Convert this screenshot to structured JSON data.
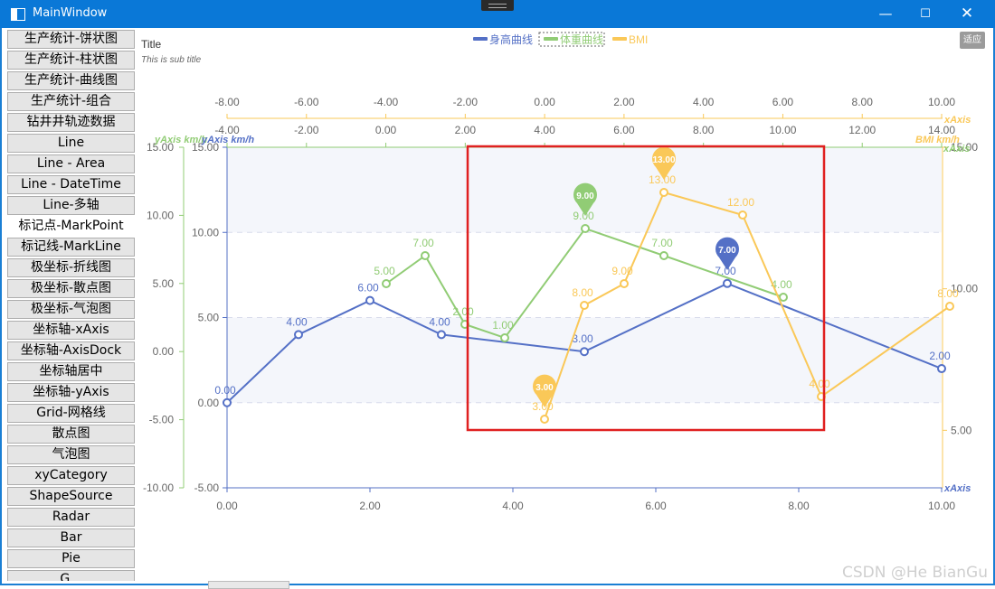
{
  "window": {
    "title": "MainWindow",
    "minimize_icon": "minimize-icon",
    "maximize_icon": "maximize-icon",
    "close_icon": "close-icon"
  },
  "sidebar": {
    "items": [
      {
        "label": "生产统计-饼状图"
      },
      {
        "label": "生产统计-柱状图"
      },
      {
        "label": "生产统计-曲线图"
      },
      {
        "label": "生产统计-组合"
      },
      {
        "label": "钻井井轨迹数据"
      },
      {
        "label": "Line"
      },
      {
        "label": "Line - Area"
      },
      {
        "label": "Line - DateTime"
      },
      {
        "label": "Line-多轴"
      },
      {
        "label": "标记点-MarkPoint",
        "selected": true
      },
      {
        "label": "标记线-MarkLine"
      },
      {
        "label": "极坐标-折线图"
      },
      {
        "label": "极坐标-散点图"
      },
      {
        "label": "极坐标-气泡图"
      },
      {
        "label": "坐标轴-xAxis"
      },
      {
        "label": "坐标轴-AxisDock"
      },
      {
        "label": "坐标轴居中"
      },
      {
        "label": "坐标轴-yAxis"
      },
      {
        "label": "Grid-网格线"
      },
      {
        "label": "散点图"
      },
      {
        "label": "气泡图"
      },
      {
        "label": "xyCategory"
      },
      {
        "label": "ShapeSource"
      },
      {
        "label": "Radar"
      },
      {
        "label": "Bar"
      },
      {
        "label": "Pie"
      },
      {
        "label": "G..."
      }
    ]
  },
  "toolbar": {
    "fit_label": "适应"
  },
  "watermark": "CSDN @He BianGu",
  "bottom_tab": "Radar",
  "chart_data": {
    "type": "line",
    "title": "Title",
    "subtitle": "This is sub title",
    "legend_position": "top",
    "legend": [
      "身高曲线",
      "体重曲线",
      "BMI"
    ],
    "colors": {
      "height": "#5470c6",
      "weight": "#91cc75",
      "bmi": "#fac858",
      "highlight": "#e02020"
    },
    "axes": {
      "x_bottom": {
        "label": "xAxis",
        "range": [
          0,
          10
        ],
        "ticks": [
          "0.00",
          "2.00",
          "4.00",
          "6.00",
          "8.00",
          "10.00"
        ]
      },
      "x_top_outer": {
        "label": "xAxis",
        "range": [
          -8,
          10
        ],
        "ticks": [
          "-8.00",
          "-6.00",
          "-4.00",
          "-2.00",
          "0.00",
          "2.00",
          "4.00",
          "6.00",
          "8.00",
          "10.00"
        ]
      },
      "x_top_inner": {
        "range": [
          -4,
          14
        ],
        "ticks": [
          "-4.00",
          "-2.00",
          "0.00",
          "2.00",
          "4.00",
          "6.00",
          "8.00",
          "10.00",
          "12.00",
          "14.00"
        ]
      },
      "y_left_inner": {
        "label": "yAxis km/h",
        "range": [
          -5,
          15
        ],
        "ticks": [
          "-5.00",
          "0.00",
          "5.00",
          "10.00",
          "15.00"
        ]
      },
      "y_left_outer": {
        "label": "yAxis km/h",
        "range": [
          -10,
          15
        ],
        "ticks": [
          "-10.00",
          "-5.00",
          "0.00",
          "5.00",
          "10.00",
          "15.00"
        ]
      },
      "y_right": {
        "label": "BMI km/h",
        "range": [
          0,
          15
        ],
        "ticks": [
          "5.00",
          "10.00",
          "15.00"
        ]
      },
      "y_right_label": "xAxis"
    },
    "series": [
      {
        "name": "身高曲线",
        "key": "height",
        "x": [
          0,
          1,
          2,
          3,
          5,
          7,
          10
        ],
        "values": [
          0,
          4,
          6,
          4,
          3,
          7,
          2
        ],
        "labels": [
          "0.00",
          "4.00",
          "6.00",
          "4.00",
          "3.00",
          "7.00",
          "2.00"
        ],
        "markpoint": "7.00"
      },
      {
        "name": "体重曲线",
        "key": "weight",
        "x": [
          -3,
          -2,
          -1,
          0,
          2,
          4,
          6
        ],
        "values": [
          5,
          7,
          2,
          1,
          9,
          7,
          4
        ],
        "labels": [
          "5.00",
          "7.00",
          "2.00",
          "1.00",
          "9.00",
          "7.00",
          "4.00"
        ],
        "markpoint": "9.00"
      },
      {
        "name": "BMI",
        "key": "bmi",
        "x": [
          -1,
          0,
          1,
          2,
          3,
          4,
          5,
          7
        ],
        "values": [
          3,
          8,
          9,
          13,
          12,
          4,
          8,
          8
        ],
        "labels": [
          "3.00",
          "8.00",
          "9.00",
          "13.00",
          "12.00",
          "4.00",
          "8.00",
          "8.00"
        ],
        "markpoints": [
          "3.00",
          "13.00"
        ]
      }
    ]
  }
}
